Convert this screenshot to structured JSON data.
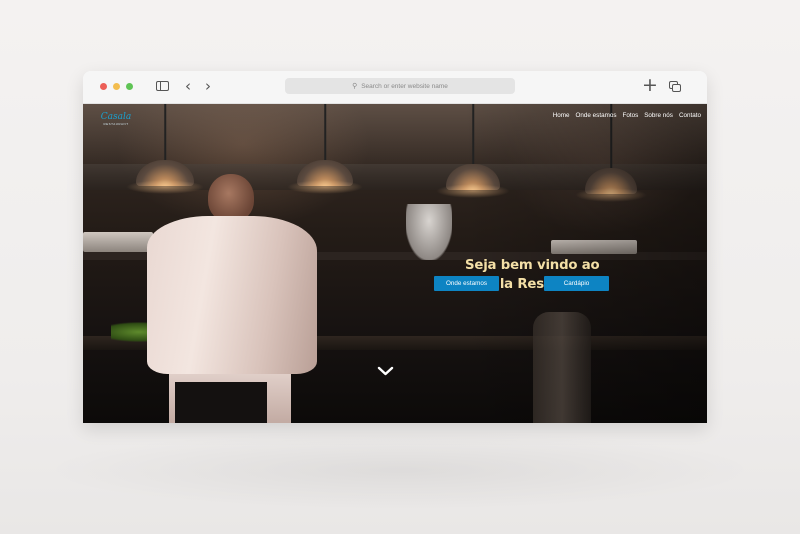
{
  "browser": {
    "address_placeholder": "Search or enter website name",
    "back_icon": "chevron-left-icon",
    "forward_icon": "chevron-right-icon",
    "new_tab_icon": "plus-icon",
    "tabs_icon": "tabs-icon",
    "sidebar_icon": "sidebar-icon"
  },
  "site": {
    "logo_text": "Casala",
    "logo_subtext": "RESTAURANT",
    "nav": [
      "Home",
      "Onde estamos",
      "Fotos",
      "Sobre nós",
      "Contato"
    ],
    "hero_title_line1": "Seja bem vindo ao",
    "hero_title_line2": "Casala Restaurant",
    "button_location": "Onde estamos",
    "button_menu": "Cardápio",
    "scroll_icon": "chevron-down-icon"
  },
  "colors": {
    "accent": "#0d84c3",
    "title": "#f3dfa6",
    "logo": "#1aa0cf"
  }
}
